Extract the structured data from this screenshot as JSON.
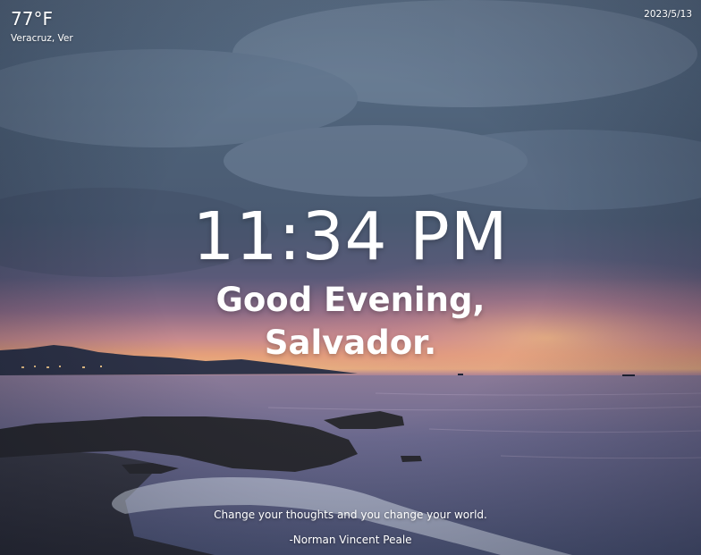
{
  "weather": {
    "temperature": "77°F",
    "location": "Veracruz, Ver",
    "icon": "weather-temperature-icon"
  },
  "date": "2023/5/13",
  "clock": {
    "time": "11:34 PM"
  },
  "greeting": {
    "line1": "Good Evening,",
    "line2": "Salvador."
  },
  "quote": {
    "text": "Change your thoughts and you change your world.",
    "author": "-Norman Vincent Peale"
  },
  "background": {
    "scene": "sunset-seaside-photo",
    "colors": {
      "sky": "#566a82",
      "horizon_glow": "#e8b27e",
      "sea": "#5e6286",
      "text": "#ffffff"
    }
  }
}
